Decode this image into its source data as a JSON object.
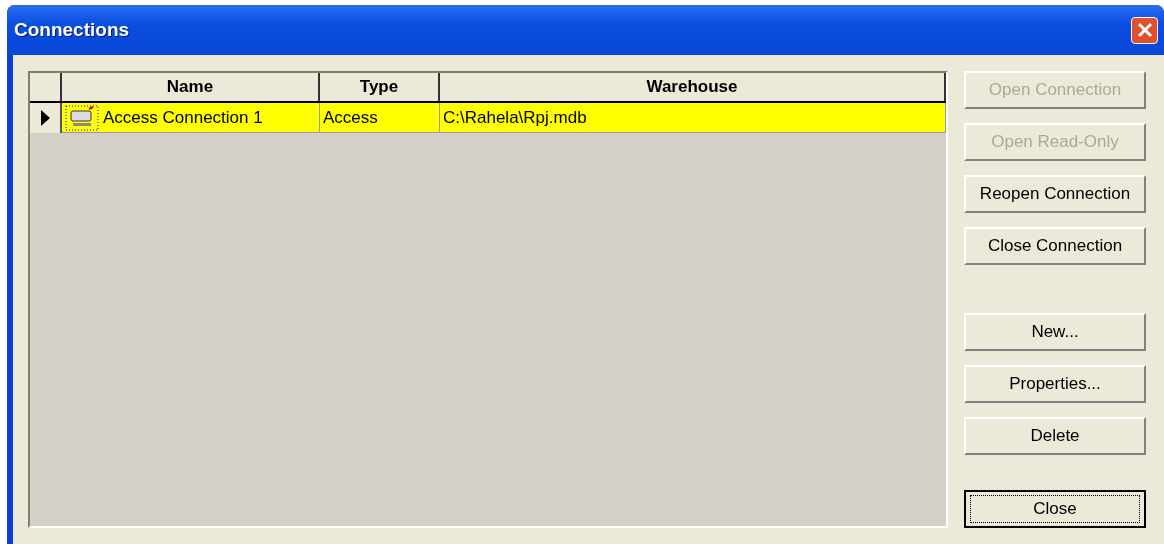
{
  "window": {
    "title": "Connections"
  },
  "table": {
    "columns": [
      "Name",
      "Type",
      "Warehouse"
    ],
    "rows": [
      {
        "selected": true,
        "current": true,
        "cells": [
          "Access Connection 1",
          "Access",
          "C:\\Rahela\\Rpj.mdb"
        ]
      }
    ]
  },
  "button_groups": [
    [
      {
        "label": "Open Connection",
        "disabled": true,
        "default": false
      },
      {
        "label": "Open Read-Only",
        "disabled": true,
        "default": false
      },
      {
        "label": "Reopen Connection",
        "disabled": false,
        "default": false
      },
      {
        "label": "Close Connection",
        "disabled": false,
        "default": false
      }
    ],
    [
      {
        "label": "New...",
        "disabled": false,
        "default": false
      },
      {
        "label": "Properties...",
        "disabled": false,
        "default": false
      },
      {
        "label": "Delete",
        "disabled": false,
        "default": false
      }
    ],
    [
      {
        "label": "Close",
        "disabled": false,
        "default": true
      }
    ]
  ]
}
